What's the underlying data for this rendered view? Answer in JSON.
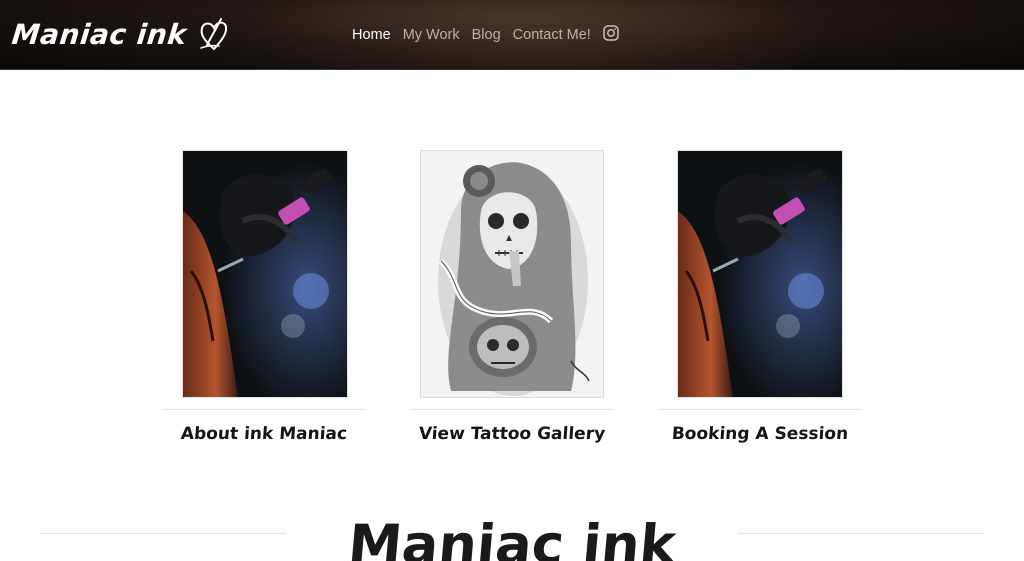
{
  "header": {
    "brand": "Maniac ink",
    "logo_icon": "heart-signature-icon",
    "nav": [
      {
        "label": "Home",
        "active": true
      },
      {
        "label": "My Work",
        "active": false
      },
      {
        "label": "Blog",
        "active": false
      },
      {
        "label": "Contact Me!",
        "active": false
      }
    ],
    "social_icon": "instagram-icon"
  },
  "cards": [
    {
      "label": "About ink Maniac",
      "image": "tattoo-artist-at-work"
    },
    {
      "label": "View Tattoo Gallery",
      "image": "sugar-skull-woman-tattoo-art"
    },
    {
      "label": "Booking A Session",
      "image": "tattoo-artist-at-work"
    }
  ],
  "section": {
    "title": "Maniac ink"
  },
  "colors": {
    "header_bg": "#1e1512",
    "nav_active": "#ffffff",
    "nav_inactive": "#b9b1ac",
    "text_dark": "#151515"
  }
}
